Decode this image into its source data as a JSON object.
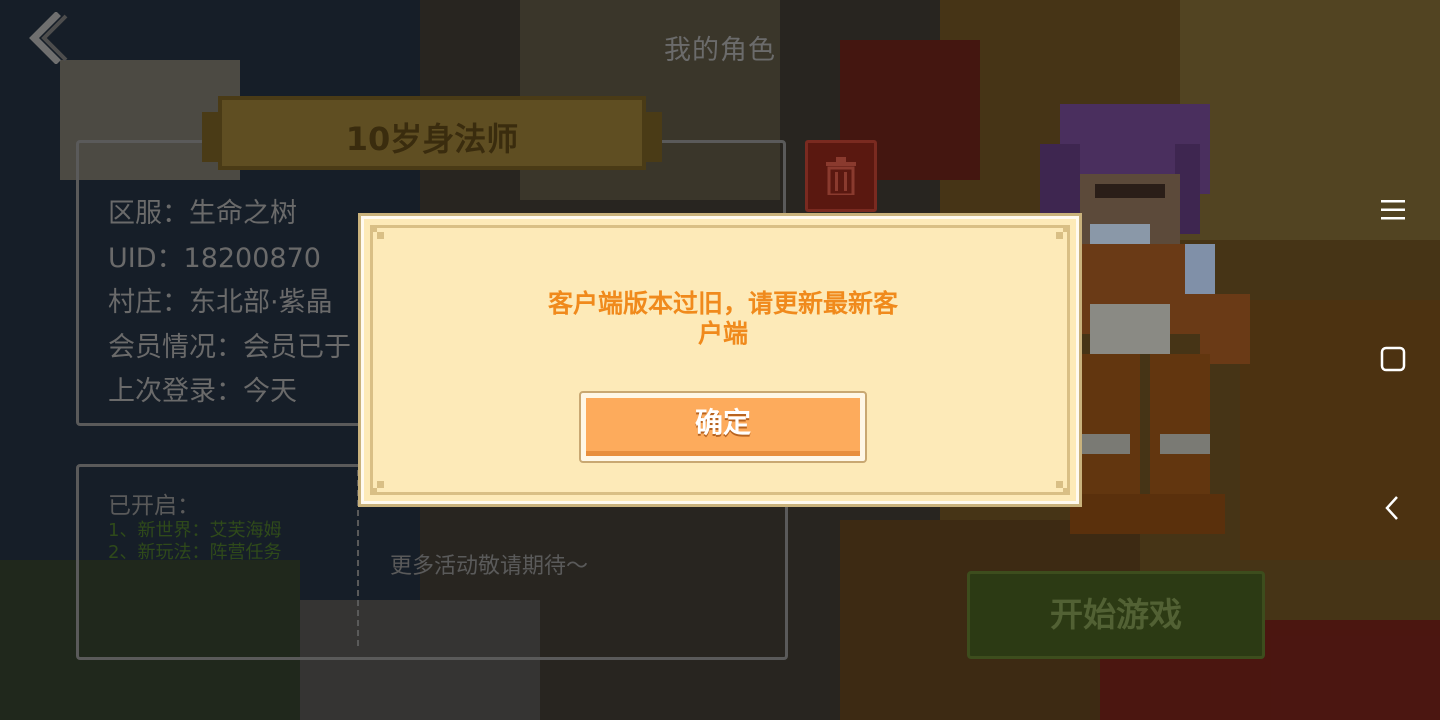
{
  "header": {
    "title": "我的角色",
    "back_icon": "chevron-left-icon"
  },
  "character": {
    "name": "10岁身法师",
    "info_lines": [
      "区服：生命之树",
      "UID：18200870",
      "村庄：东北部·紫晶",
      "会员情况：会员已于",
      "上次登录：今天"
    ],
    "delete_icon": "trash-icon"
  },
  "events": {
    "heading": "已开启：",
    "items": [
      "1、新世界：艾芙海姆",
      "2、新玩法：阵营任务"
    ],
    "more": "更多活动敬请期待～"
  },
  "start_button": {
    "label": "开始游戏"
  },
  "dialog": {
    "message": "客户端版本过旧，请更新最新客\n户端",
    "confirm_label": "确定"
  },
  "system_nav": {
    "menu_icon": "menu-icon",
    "home_icon": "square-icon",
    "back_icon": "back-triangle-icon"
  },
  "colors": {
    "dialog_bg": "#fdeab8",
    "dialog_text": "#f08a1c",
    "confirm_button": "#fdab5c",
    "start_button": "#2c3a14"
  }
}
